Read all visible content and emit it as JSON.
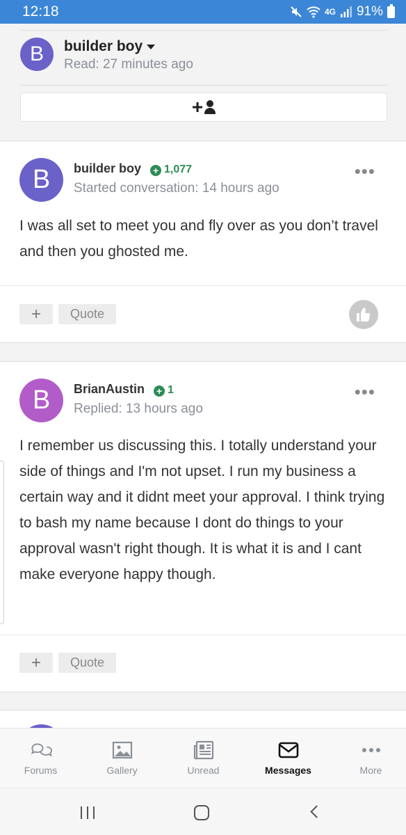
{
  "status_bar": {
    "time": "12:18",
    "network": "4G",
    "battery": "91%",
    "icons": [
      "mute-icon",
      "wifi-icon",
      "signal-icon",
      "battery-icon"
    ]
  },
  "conversation_header": {
    "avatar_letter": "B",
    "name": "builder boy",
    "read_status": "Read: 27 minutes ago",
    "add_participant_icon": "add-person-icon"
  },
  "messages": [
    {
      "avatar_letter": "B",
      "avatar_color": "#6a61c9",
      "author": "builder boy",
      "reputation": "1,077",
      "meta": "Started conversation: 14 hours ago",
      "body": "I was all set to meet you and fly over as you don’t travel and then you ghosted me.",
      "plus_label": "+",
      "quote_label": "Quote",
      "has_like": true
    },
    {
      "avatar_letter": "B",
      "avatar_color": "#b25cc9",
      "author": "BrianAustin",
      "reputation": "1",
      "meta": "Replied: 13 hours ago",
      "body": "I remember us discussing this. I totally understand your side of things and I'm not upset. I run my business a certain way and it didnt meet your approval. I think trying to bash my name because I dont do things to your approval wasn't right though. It is what it is and I cant make everyone happy though.",
      "plus_label": "+",
      "quote_label": "Quote",
      "has_like": false
    }
  ],
  "colors": {
    "status_bar": "#3b86d6",
    "reputation_green": "#2e8b57",
    "avatar_builder": "#6a61c9",
    "avatar_brian": "#b25cc9"
  },
  "tabbar": {
    "items": [
      {
        "label": "Forums",
        "icon": "forums-icon",
        "active": false
      },
      {
        "label": "Gallery",
        "icon": "gallery-icon",
        "active": false
      },
      {
        "label": "Unread",
        "icon": "unread-icon",
        "active": false
      },
      {
        "label": "Messages",
        "icon": "messages-icon",
        "active": true
      },
      {
        "label": "More",
        "icon": "more-icon",
        "active": false
      }
    ]
  },
  "android_nav": [
    "recent-apps-icon",
    "home-icon",
    "back-icon"
  ]
}
